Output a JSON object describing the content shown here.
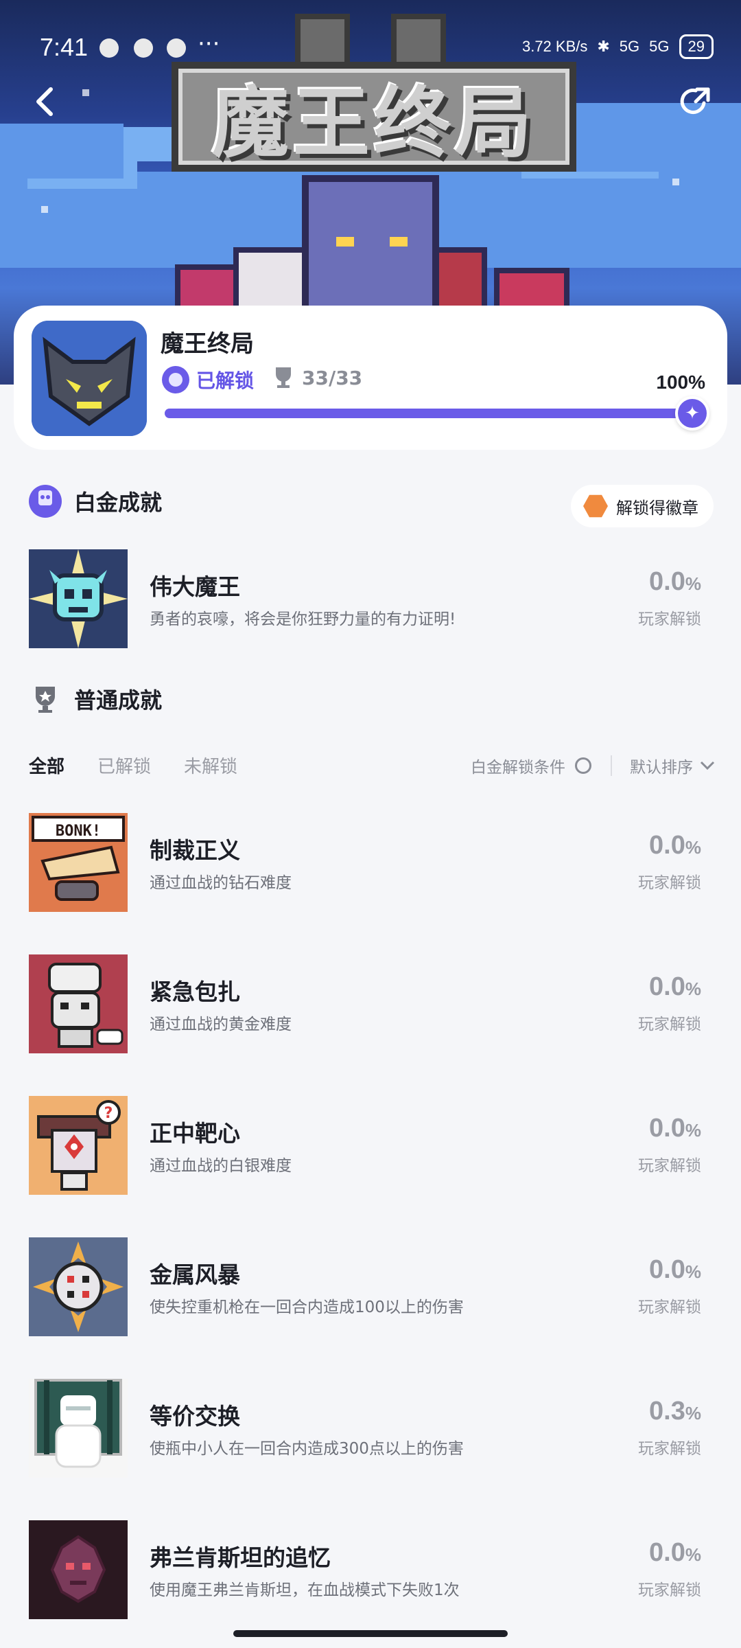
{
  "status_bar": {
    "time": "7:41",
    "network_speed": "3.72 KB/s",
    "signal1": "5G",
    "signal2": "5G",
    "battery": "29"
  },
  "hero": {
    "game_logo_text": "魔王终局"
  },
  "summary": {
    "game_name": "魔王终局",
    "unlocked_label": "已解锁",
    "trophy_count": "33/33",
    "progress_percent": "100%",
    "progress_fraction": 1.0
  },
  "platinum": {
    "heading": "白金成就",
    "badge_button": "解锁得徽章",
    "item": {
      "title": "伟大魔王",
      "desc": "勇者的哀嚎，将会是你狂野力量的有力证明!",
      "rate": "0.0",
      "rate_unit": "%",
      "rate_label": "玩家解锁"
    }
  },
  "normal": {
    "heading": "普通成就",
    "tabs": [
      "全部",
      "已解锁",
      "未解锁"
    ],
    "condition_toggle": "白金解锁条件",
    "sort": "默认排序",
    "items": [
      {
        "title": "制裁正义",
        "desc": "通过血战的钻石难度",
        "rate": "0.0",
        "rate_unit": "%",
        "rate_label": "玩家解锁"
      },
      {
        "title": "紧急包扎",
        "desc": "通过血战的黄金难度",
        "rate": "0.0",
        "rate_unit": "%",
        "rate_label": "玩家解锁"
      },
      {
        "title": "正中靶心",
        "desc": "通过血战的白银难度",
        "rate": "0.0",
        "rate_unit": "%",
        "rate_label": "玩家解锁"
      },
      {
        "title": "金属风暴",
        "desc": "使失控重机枪在一回合内造成100以上的伤害",
        "rate": "0.0",
        "rate_unit": "%",
        "rate_label": "玩家解锁"
      },
      {
        "title": "等价交换",
        "desc": "使瓶中小人在一回合内造成300点以上的伤害",
        "rate": "0.3",
        "rate_unit": "%",
        "rate_label": "玩家解锁"
      },
      {
        "title": "弗兰肯斯坦的追忆",
        "desc": "使用魔王弗兰肯斯坦，在血战模式下失败1次",
        "rate": "0.0",
        "rate_unit": "%",
        "rate_label": "玩家解锁"
      }
    ]
  },
  "icons": {
    "back": "back-arrow-icon",
    "share": "share-icon",
    "trophy": "trophy-icon",
    "badge": "badge-icon",
    "chevron": "chevron-down-icon"
  },
  "colors": {
    "accent": "#6a5be8",
    "muted": "#9a9ca4",
    "background": "#f5f6f9"
  }
}
